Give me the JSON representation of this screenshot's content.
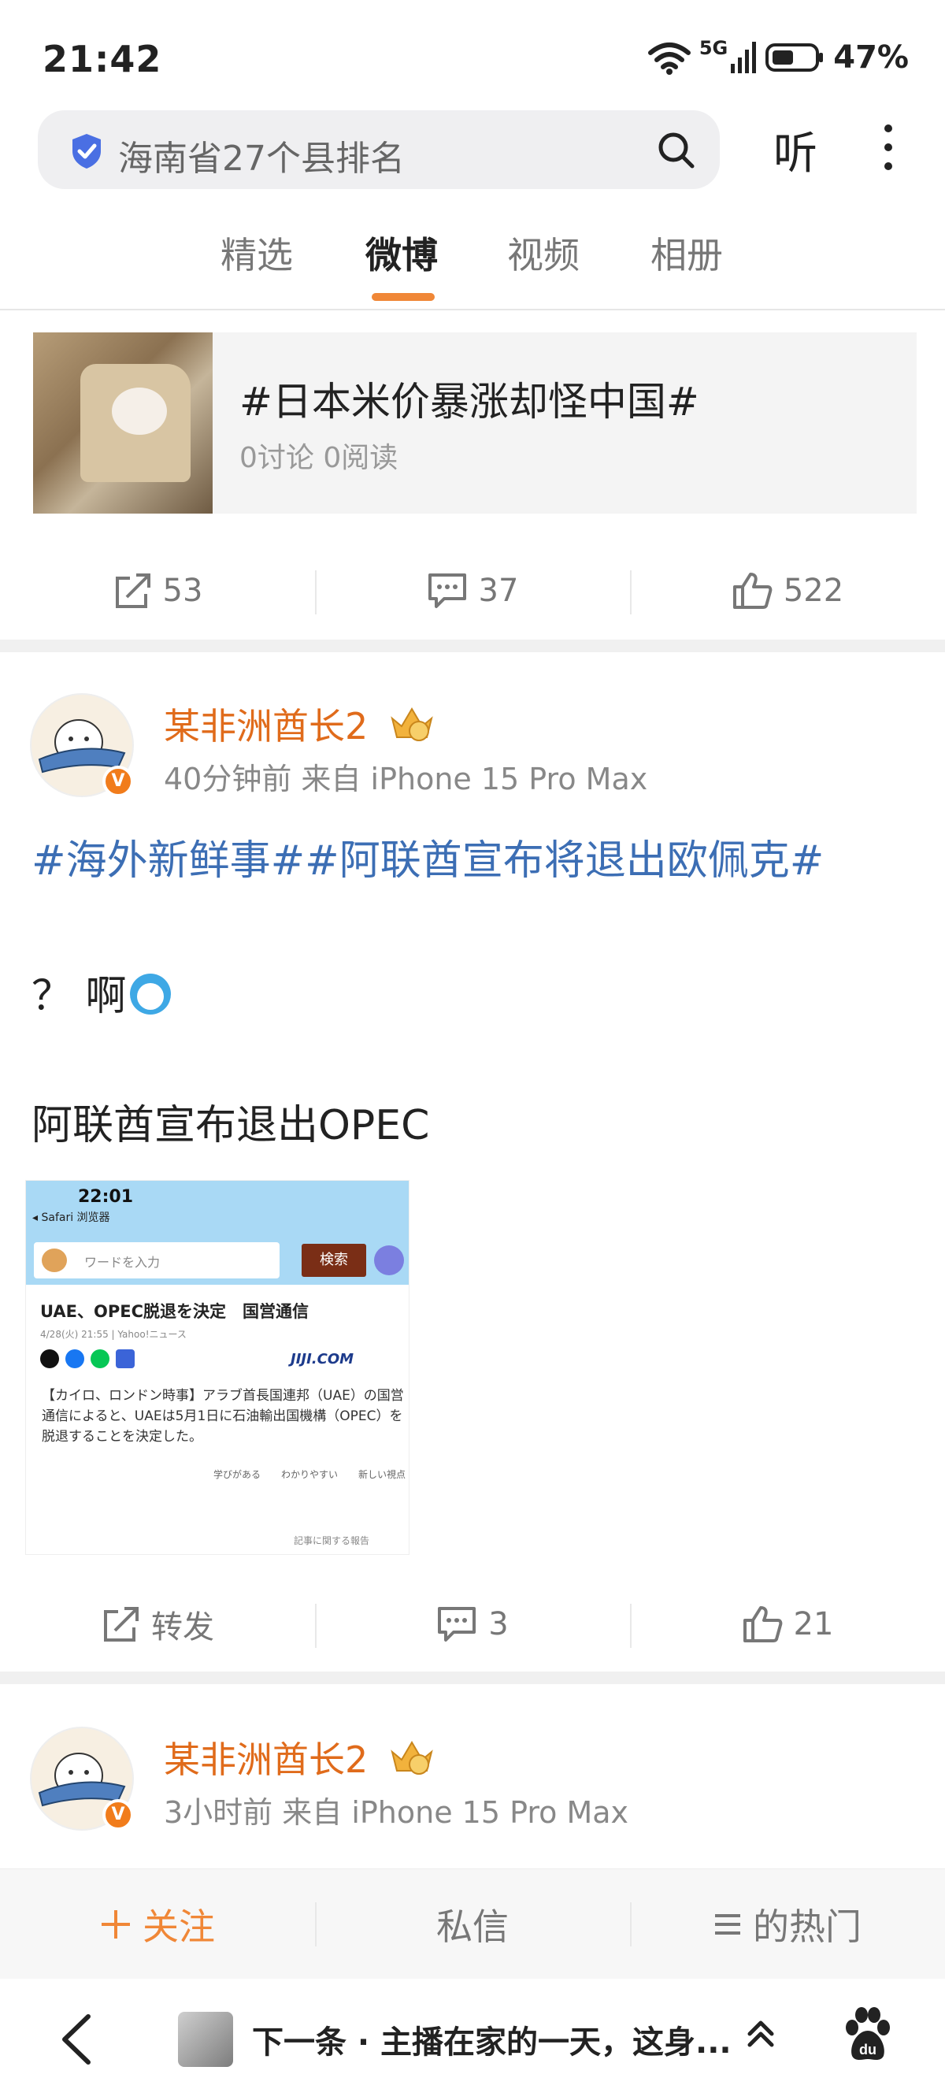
{
  "status_bar": {
    "time": "21:42",
    "network": "5G",
    "battery": "47%"
  },
  "search": {
    "query": "海南省27个县排名",
    "listen_label": "听"
  },
  "tabs": [
    {
      "label": "精选"
    },
    {
      "label": "微博"
    },
    {
      "label": "视频"
    },
    {
      "label": "相册"
    }
  ],
  "active_tab": "微博",
  "topic_card": {
    "title": "#日本米价暴涨却怪中国#",
    "meta": "0讨论 0阅读"
  },
  "post1_actions": {
    "repost": "53",
    "comment": "37",
    "like": "522"
  },
  "post2": {
    "username": "某非洲酋长2",
    "meta": "40分钟前 来自 iPhone 15 Pro Max",
    "hashtags": "#海外新鲜事##阿联酋宣布将退出欧佩克#",
    "line1": "？ 啊",
    "line2": "阿联酋宣布退出OPEC",
    "image": {
      "time": "22:01",
      "browser": "◂ Safari 浏览器",
      "search_placeholder": "ワードを入力",
      "search_button": "検索",
      "headline": "UAE、OPEC脱退を決定　国営通信",
      "date": "4/28(火) 21:55 | Yahoo!ニュース",
      "source": "JIJI.COM",
      "body": "【カイロ、ロンドン時事】アラブ首長国連邦（UAE）の国営通信によると、UAEは5月1日に石油輸出国機構（OPEC）を脱退することを決定した。",
      "reactions": [
        "学びがある",
        "わかりやすい",
        "新しい視点"
      ],
      "report": "記事に関する報告"
    },
    "actions": {
      "repost": "转发",
      "comment": "3",
      "like": "21"
    }
  },
  "post3": {
    "username": "某非洲酋长2",
    "meta": "3小时前 来自 iPhone 15 Pro Max"
  },
  "follow_bar": {
    "follow": "关注",
    "message": "私信",
    "hot": "的热门"
  },
  "browser_bar": {
    "next_text": "下一条 · 主播在家的一天，这身..."
  },
  "colors": {
    "accent": "#f08737",
    "hashtag": "#3c6eb4",
    "username": "#e06b1b"
  }
}
